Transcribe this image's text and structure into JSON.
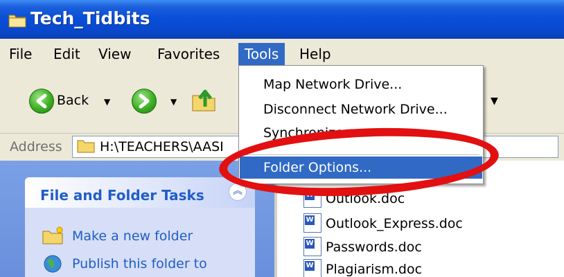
{
  "window": {
    "title": "Tech_Tidbits"
  },
  "menubar": {
    "items": [
      "File",
      "Edit",
      "View",
      "Favorites",
      "Tools",
      "Help"
    ],
    "active": "Tools"
  },
  "toolbar": {
    "back_label": "Back"
  },
  "address": {
    "label": "Address",
    "value": "H:\\TEACHERS\\AASI"
  },
  "tools_menu": {
    "items": [
      "Map Network Drive...",
      "Disconnect Network Drive...",
      "Synchronize...",
      "Folder Options..."
    ],
    "highlighted": "Folder Options..."
  },
  "tasks_pane": {
    "title": "File and Folder Tasks",
    "items": [
      "Make a new folder",
      "Publish this folder to"
    ]
  },
  "files": [
    "Outlook.doc",
    "Outlook_Express.doc",
    "Passwords.doc",
    "Plagiarism.doc"
  ],
  "colors": {
    "titlebar": "#0a4fd8",
    "menu_highlight": "#316ac5",
    "annotation": "#e21010"
  }
}
